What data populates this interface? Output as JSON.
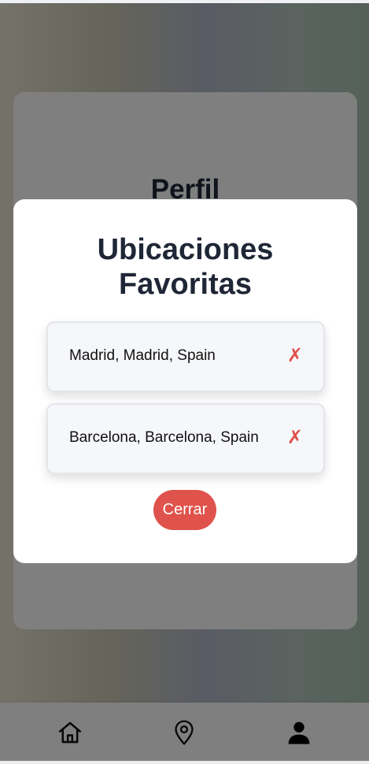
{
  "profile": {
    "title": "Perfil"
  },
  "modal": {
    "title": "Ubicaciones Favoritas",
    "favorites": [
      {
        "label": "Madrid, Madrid, Spain",
        "remove_icon": "✗"
      },
      {
        "label": "Barcelona, Barcelona, Spain",
        "remove_icon": "✗"
      }
    ],
    "close_label": "Cerrar"
  },
  "nav": {
    "items": [
      {
        "name": "home",
        "icon": "home-icon"
      },
      {
        "name": "locations",
        "icon": "map-pin-icon"
      },
      {
        "name": "profile",
        "icon": "user-icon",
        "active": true
      }
    ]
  },
  "colors": {
    "accent": "#e0524c",
    "text_dark": "#1f2636"
  }
}
